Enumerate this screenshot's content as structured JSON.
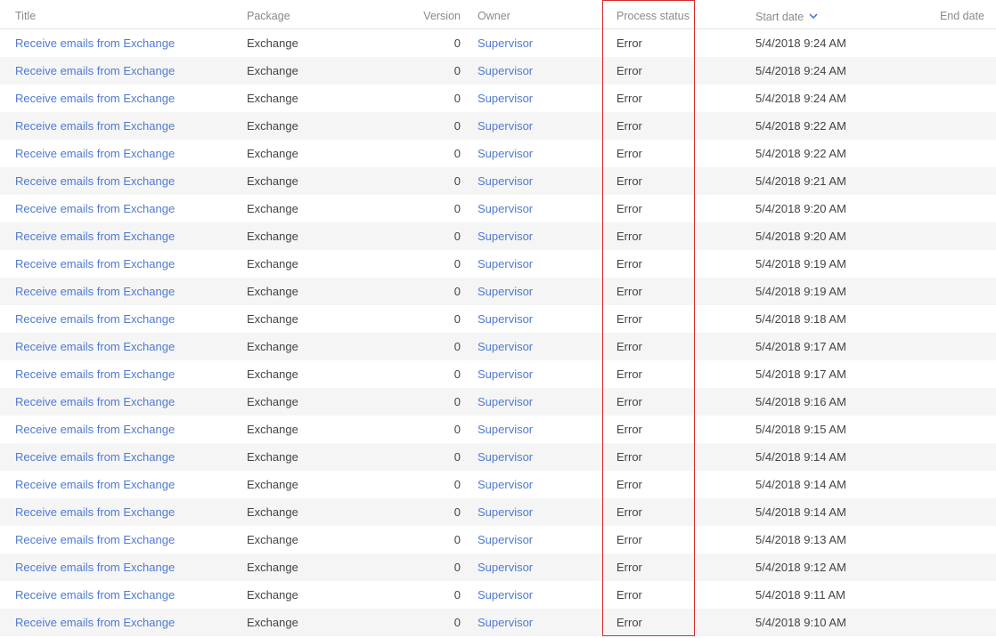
{
  "columns": {
    "title": "Title",
    "package": "Package",
    "version": "Version",
    "owner": "Owner",
    "status": "Process status",
    "start_date": "Start date",
    "end_date": "End date"
  },
  "sort": {
    "column": "start_date",
    "direction": "descending",
    "icon": "chevron-down-icon"
  },
  "colors": {
    "link": "#4f7ad2",
    "highlight_border": "#d42a2a",
    "row_alt": "#f5f5f5"
  },
  "rows": [
    {
      "title": "Receive emails from Exchange",
      "package": "Exchange",
      "version": "0",
      "owner": "Supervisor",
      "status": "Error",
      "start": "5/4/2018 9:24 AM",
      "end": ""
    },
    {
      "title": "Receive emails from Exchange",
      "package": "Exchange",
      "version": "0",
      "owner": "Supervisor",
      "status": "Error",
      "start": "5/4/2018 9:24 AM",
      "end": ""
    },
    {
      "title": "Receive emails from Exchange",
      "package": "Exchange",
      "version": "0",
      "owner": "Supervisor",
      "status": "Error",
      "start": "5/4/2018 9:24 AM",
      "end": ""
    },
    {
      "title": "Receive emails from Exchange",
      "package": "Exchange",
      "version": "0",
      "owner": "Supervisor",
      "status": "Error",
      "start": "5/4/2018 9:22 AM",
      "end": ""
    },
    {
      "title": "Receive emails from Exchange",
      "package": "Exchange",
      "version": "0",
      "owner": "Supervisor",
      "status": "Error",
      "start": "5/4/2018 9:22 AM",
      "end": ""
    },
    {
      "title": "Receive emails from Exchange",
      "package": "Exchange",
      "version": "0",
      "owner": "Supervisor",
      "status": "Error",
      "start": "5/4/2018 9:21 AM",
      "end": ""
    },
    {
      "title": "Receive emails from Exchange",
      "package": "Exchange",
      "version": "0",
      "owner": "Supervisor",
      "status": "Error",
      "start": "5/4/2018 9:20 AM",
      "end": ""
    },
    {
      "title": "Receive emails from Exchange",
      "package": "Exchange",
      "version": "0",
      "owner": "Supervisor",
      "status": "Error",
      "start": "5/4/2018 9:20 AM",
      "end": ""
    },
    {
      "title": "Receive emails from Exchange",
      "package": "Exchange",
      "version": "0",
      "owner": "Supervisor",
      "status": "Error",
      "start": "5/4/2018 9:19 AM",
      "end": ""
    },
    {
      "title": "Receive emails from Exchange",
      "package": "Exchange",
      "version": "0",
      "owner": "Supervisor",
      "status": "Error",
      "start": "5/4/2018 9:19 AM",
      "end": ""
    },
    {
      "title": "Receive emails from Exchange",
      "package": "Exchange",
      "version": "0",
      "owner": "Supervisor",
      "status": "Error",
      "start": "5/4/2018 9:18 AM",
      "end": ""
    },
    {
      "title": "Receive emails from Exchange",
      "package": "Exchange",
      "version": "0",
      "owner": "Supervisor",
      "status": "Error",
      "start": "5/4/2018 9:17 AM",
      "end": ""
    },
    {
      "title": "Receive emails from Exchange",
      "package": "Exchange",
      "version": "0",
      "owner": "Supervisor",
      "status": "Error",
      "start": "5/4/2018 9:17 AM",
      "end": ""
    },
    {
      "title": "Receive emails from Exchange",
      "package": "Exchange",
      "version": "0",
      "owner": "Supervisor",
      "status": "Error",
      "start": "5/4/2018 9:16 AM",
      "end": ""
    },
    {
      "title": "Receive emails from Exchange",
      "package": "Exchange",
      "version": "0",
      "owner": "Supervisor",
      "status": "Error",
      "start": "5/4/2018 9:15 AM",
      "end": ""
    },
    {
      "title": "Receive emails from Exchange",
      "package": "Exchange",
      "version": "0",
      "owner": "Supervisor",
      "status": "Error",
      "start": "5/4/2018 9:14 AM",
      "end": ""
    },
    {
      "title": "Receive emails from Exchange",
      "package": "Exchange",
      "version": "0",
      "owner": "Supervisor",
      "status": "Error",
      "start": "5/4/2018 9:14 AM",
      "end": ""
    },
    {
      "title": "Receive emails from Exchange",
      "package": "Exchange",
      "version": "0",
      "owner": "Supervisor",
      "status": "Error",
      "start": "5/4/2018 9:14 AM",
      "end": ""
    },
    {
      "title": "Receive emails from Exchange",
      "package": "Exchange",
      "version": "0",
      "owner": "Supervisor",
      "status": "Error",
      "start": "5/4/2018 9:13 AM",
      "end": ""
    },
    {
      "title": "Receive emails from Exchange",
      "package": "Exchange",
      "version": "0",
      "owner": "Supervisor",
      "status": "Error",
      "start": "5/4/2018 9:12 AM",
      "end": ""
    },
    {
      "title": "Receive emails from Exchange",
      "package": "Exchange",
      "version": "0",
      "owner": "Supervisor",
      "status": "Error",
      "start": "5/4/2018 9:11 AM",
      "end": ""
    },
    {
      "title": "Receive emails from Exchange",
      "package": "Exchange",
      "version": "0",
      "owner": "Supervisor",
      "status": "Error",
      "start": "5/4/2018 9:10 AM",
      "end": ""
    }
  ]
}
